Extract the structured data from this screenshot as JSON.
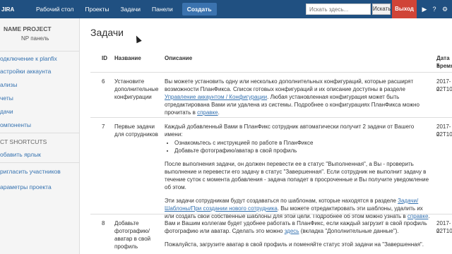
{
  "topbar": {
    "logo": "JIRA",
    "nav": [
      "Рабочий стол",
      "Проекты",
      "Задачи",
      "Панели"
    ],
    "create": "Создать",
    "search_placeholder": "Искать здесь...",
    "search_button": "Искать",
    "logout": "Выход"
  },
  "sidebar": {
    "project_name": "NAME PROJECT",
    "project_sub": "NP панель",
    "items": [
      "одключение к planfix",
      "астройки аккаунта",
      "ализы",
      "четы",
      "дачи",
      "омпоненты"
    ],
    "shortcuts_header": "CT SHORTCUTS",
    "add_shortcut": "обавить ярлык",
    "bottom_items": [
      "ригласить участников",
      "араметры проекта"
    ]
  },
  "main": {
    "title": "Задачи",
    "headers": {
      "id": "ID",
      "name": "Название",
      "desc": "Описание",
      "date": "Дата к",
      "date2": "время"
    },
    "rows": [
      {
        "id": "6",
        "name": "Установите дополнительные конфигурации",
        "desc_a": "Вы можете установить одну или несколько дополнительных конфигураций, которые расширят возможности ПланФикса. Список готовых конфигураций и их описание доступны в разделе ",
        "desc_link1": "Управление аккаунтом / Конфигурации",
        "desc_b": ". Любая установленная конфигурация может быть отредактирована Вами или удалена из системы. Подробнее о конфигурациях ПланФикса можно прочитать в ",
        "desc_link2": "справке",
        "desc_c": ".",
        "date1": "2017-0",
        "date2": "22T10"
      },
      {
        "id": "7",
        "name": "Первые задачи для сотрудников",
        "p1": "Каждый добавленный Вами в ПланФикс сотрудник автоматически получит 2 задачи от Вашего имени:",
        "li1": "Ознакомьтесь с инструкцией по работе в ПланФиксе",
        "li2": "Добавьте фотографию/аватар в свой профиль",
        "p2": "После выполнения задачи, он должен перевести ее в статус \"Выполненная\", а Вы - проверить выполнение и перевести его задачу в статус \"Завершенная\". Если сотрудник не выполнит задачу в течение суток с момента добавления - задача попадет в просроченные и Вы получите уведомление об этом.",
        "p3_a": "Эти задачи сотрудникам будут создаваться по шаблонам, которые находятся в разделе ",
        "p3_link1": "Задачи/ Шаблоны/При создании нового сотрудника",
        "p3_b": ". Вы можете отредактировать эти шаблоны, удалить их или создать свои собственные шаблоны для этой цели. Подробнее об этом можно узнать в ",
        "p3_link2": "справке",
        "p3_c": ".",
        "date1": "2017-0",
        "date2": "22T10"
      },
      {
        "id": "8",
        "name": "Добавьте фотографию/ аватар в свой профиль",
        "p1_a": "Вам и Вашим коллегам будет удобнее работать в ПланФикс, если каждый загрузит в свой профиль фотографию или аватар. Сделать это можно ",
        "p1_link": "здесь",
        "p1_b": " (вкладка \"Дополнительные данные\").",
        "p2": "Пожалуйста, загрузите аватар в свой профиль и поменяйте статус этой задачи на \"Завершенная\".",
        "date1": "2017-0",
        "date2": "22T10"
      }
    ]
  }
}
